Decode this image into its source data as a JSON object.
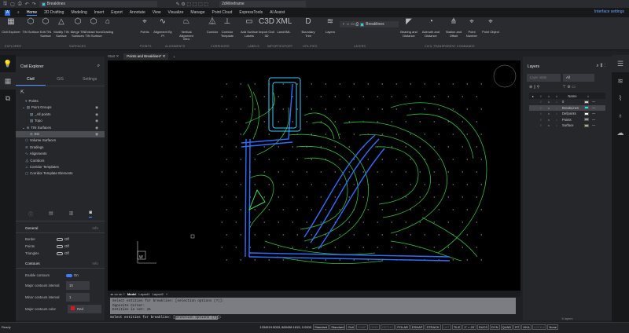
{
  "quick_access": {
    "current_layer": "Breaklines",
    "visual_style": "2dWireframe",
    "layer_color": "#22d3e6"
  },
  "menu": {
    "tabs": [
      "Home",
      "2D Drafting",
      "Modeling",
      "Insert",
      "Export",
      "Annotate",
      "View",
      "Visualize",
      "Manage",
      "Point Cloud",
      "ExpressTools",
      "AI Assist"
    ],
    "interface_settings": "Interface settings"
  },
  "ribbon": {
    "tools": [
      {
        "label": "Civil Explorer",
        "glyph": "▦"
      },
      {
        "label": "TIN Surface",
        "glyph": "⬡"
      },
      {
        "label": "Edit TIN Surface",
        "glyph": "⬡"
      },
      {
        "label": "Modify TIN Surface",
        "glyph": "△"
      },
      {
        "label": "Merge TIN Surfaces",
        "glyph": "⬡"
      },
      {
        "label": "Extract from TIN Surface",
        "glyph": "⬡"
      },
      {
        "label": "Grading",
        "glyph": "⌂"
      },
      {
        "label": "Points",
        "glyph": "⌖"
      },
      {
        "label": "Alignment By PI",
        "glyph": "∿"
      },
      {
        "label": "Vertical Alignment View",
        "glyph": "⏢"
      },
      {
        "label": "Corridor",
        "glyph": "⏅"
      },
      {
        "label": "Corridor Template",
        "glyph": "⊥"
      },
      {
        "label": "Add Surface Labels",
        "glyph": "▭"
      },
      {
        "label": "Import Civil 3D",
        "glyph": "C3D"
      },
      {
        "label": "LandXML",
        "glyph": "XML"
      },
      {
        "label": "Boundary Trim",
        "glyph": "D"
      },
      {
        "label": "Layers",
        "glyph": "≋"
      },
      {
        "label": "Bearing and Distance",
        "glyph": "◤"
      },
      {
        "label": "Azimuth and Distance",
        "glyph": "◔"
      },
      {
        "label": "Station and Offset",
        "glyph": "⋔"
      },
      {
        "label": "Point Number",
        "glyph": "⌖"
      },
      {
        "label": "Point Object",
        "glyph": "⌖"
      }
    ],
    "groups": [
      "EXPLORER",
      "SURFACES",
      "POINTS",
      "ALIGNMENTS",
      "CORRIDORS",
      "LABELS",
      "IMPORT/EXPORT",
      "UTILITIES",
      "LAYERS",
      "CIVIL TRANSPARENT COMMANDS"
    ],
    "layer_name": "Breaklines"
  },
  "explorer": {
    "title": "Civil Explorer",
    "tabs": [
      "Civil",
      "GIS",
      "Settings"
    ],
    "tree": [
      "Points",
      "Point Groups",
      "_All points",
      "Topo",
      "TIN Surfaces",
      "EG",
      "Volume Surfaces",
      "Gradings",
      "Alignments",
      "Corridors",
      "Corridor Templates",
      "Corridor Template Elements"
    ]
  },
  "properties": {
    "general": "General",
    "info": "Info",
    "border": "Border",
    "points": "Points",
    "triangles": "Triangles",
    "off": "Off",
    "contours": "Contours",
    "enable_contours": "Enable contours",
    "on": "On",
    "major_interval_label": "Major contours interval",
    "major_interval": "10",
    "minor_interval_label": "Minor contours interval",
    "minor_interval": "1",
    "major_color_label": "Major contours color",
    "major_color": "Red",
    "major_color_hex": "#e0141e"
  },
  "documents": {
    "tabs": [
      "Start",
      "Points and Breaklines*"
    ]
  },
  "layout_tabs": [
    "Model",
    "Layout1",
    "Layout2",
    "+"
  ],
  "command": {
    "history": [
      "Select entities for breakline: [selection options (?)]:",
      "Opposite Corner:",
      "Entities in set: 21"
    ],
    "prompt": "Select entities for breakline: ",
    "prompt_option": "selection options (?)",
    "prompt_end": "]:"
  },
  "status": {
    "ready": "Ready",
    "coords": "1334519.5053, 889498.1815, 0.0000",
    "items": [
      "Standard",
      "Standard",
      "Civil",
      "SNAP",
      "GRID",
      "ORTHO",
      "POLAR",
      "ESNAP",
      "STRACK",
      "LWT",
      "TILE",
      "1\" = 20'",
      "DUCS",
      "DYN",
      "QUAD",
      "RT",
      "HKA",
      "LOCKUI",
      "None"
    ],
    "off": [
      "SNAP",
      "GRID",
      "ORTHO",
      "LWT",
      "LOCKUI"
    ]
  },
  "layers": {
    "title": "Layers",
    "state_placeholder": "Layer state",
    "filter": "All",
    "col_name": "Name",
    "count": "5 layers",
    "rows": [
      {
        "name": "0",
        "color": "#d0d0d0"
      },
      {
        "name": "BreakLines",
        "color": "#22e0e6"
      },
      {
        "name": "Defpoints",
        "color": "#ffffff"
      },
      {
        "name": "Points",
        "color": "#9a9a9a"
      },
      {
        "name": "Surface",
        "color": "#b8b07a"
      }
    ]
  },
  "ucs": {
    "w_label": "W"
  }
}
